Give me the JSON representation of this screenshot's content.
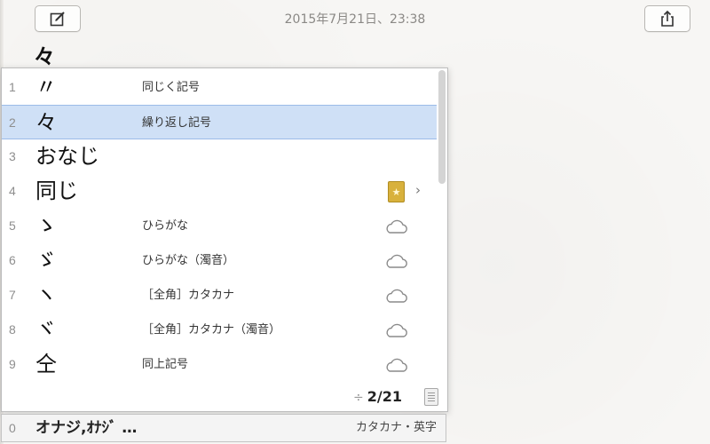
{
  "header": {
    "date": "2015年7月21日、23:38",
    "compose_icon": "compose-icon",
    "share_icon": "share-icon"
  },
  "document": {
    "text": "々"
  },
  "candidates": [
    {
      "num": "1",
      "word": "〃",
      "annotation": "同じく記号",
      "icon": "",
      "selected": false
    },
    {
      "num": "2",
      "word": "々",
      "annotation": "繰り返し記号",
      "icon": "",
      "selected": true
    },
    {
      "num": "3",
      "word": "おなじ",
      "annotation": "",
      "icon": "",
      "selected": false
    },
    {
      "num": "4",
      "word": "同じ",
      "annotation": "",
      "icon": "dictionary-icon",
      "selected": false
    },
    {
      "num": "5",
      "word": "ゝ",
      "annotation": "ひらがな",
      "icon": "cloud-icon",
      "selected": false
    },
    {
      "num": "6",
      "word": "ゞ",
      "annotation": "ひらがな（濁音）",
      "icon": "cloud-icon",
      "selected": false
    },
    {
      "num": "7",
      "word": "ヽ",
      "annotation": "［全角］カタカナ",
      "icon": "cloud-icon",
      "selected": false
    },
    {
      "num": "8",
      "word": "ヾ",
      "annotation": "［全角］カタカナ（濁音）",
      "icon": "cloud-icon",
      "selected": false
    },
    {
      "num": "9",
      "word": "仝",
      "annotation": "同上記号",
      "icon": "cloud-icon",
      "selected": false
    }
  ],
  "pagination": {
    "arrows": "÷",
    "value": "2/21"
  },
  "input_row": {
    "num": "0",
    "text": "オナジ,ｵﾅｼﾞ …",
    "mode": "カタカナ・英字"
  },
  "colors": {
    "selection": "#cfe0f6",
    "selection_border": "#9bbbe8",
    "dictionary_badge": "#d8b13c"
  }
}
